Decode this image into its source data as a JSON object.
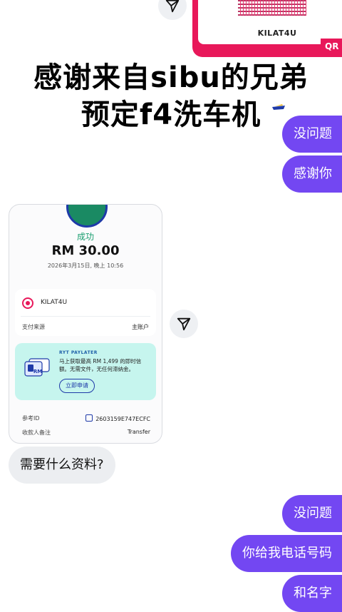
{
  "qr_card": {
    "merchant": "KILAT4U",
    "tag": "QR"
  },
  "caption": {
    "line1": "感谢来自sibu的兄弟",
    "line2": "预定f4洗车机"
  },
  "messages": {
    "out1": "没问题",
    "out2": "感谢你",
    "in1": "需要什么资料?",
    "out3": "没问题",
    "out4": "你给我电话号码",
    "out5": "和名字"
  },
  "receipt": {
    "status": "成功",
    "amount": "RM 30.00",
    "datetime": "2026年3月15日, 晚上 10:56",
    "merchant": "KILAT4U",
    "source_label": "支付来源",
    "source_value": "主账户",
    "promo": {
      "title": "RYT PAYLATER",
      "text": "马上获取最高 RM 1,499 的即时信额。无需文件，无任何滞纳金。",
      "icon_label": "RM",
      "button": "立即申请"
    },
    "ref_label": "参考ID",
    "ref_value": "2603159E747ECFC",
    "note_label": "收款人备注",
    "note_value": "Transfer"
  },
  "colors": {
    "accent_purple": "#7347f2",
    "brand_pink": "#e8185a",
    "success_green": "#1a9e6f"
  }
}
